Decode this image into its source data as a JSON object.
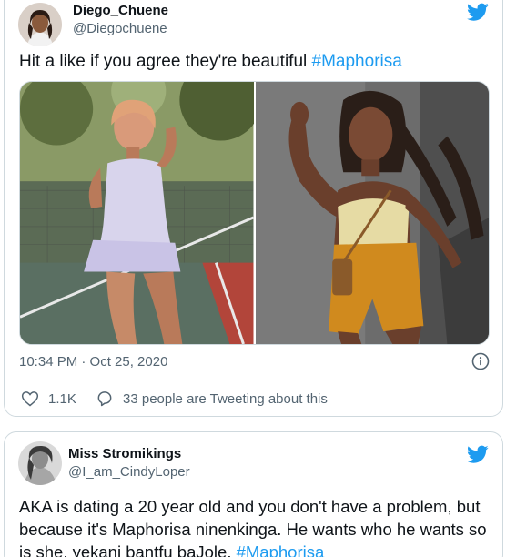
{
  "tweet1": {
    "display_name": "Diego_Chuene",
    "handle": "@Diegochuene",
    "text": "Hit a like if you agree they're beautiful ",
    "hashtag": "#Maphorisa",
    "timestamp": "10:34 PM · Oct 25, 2020",
    "like_count": "1.1K",
    "reply_text": "33 people are Tweeting about this",
    "icons": {
      "brand": "twitter-bird-icon",
      "info": "info-icon",
      "like": "heart-icon",
      "reply": "chat-bubble-icon"
    }
  },
  "tweet2": {
    "display_name": "Miss Stromikings",
    "handle": "@I_am_CindyLoper",
    "text": "AKA is dating a 20 year old and you don't have a problem, but because it's Maphorisa ninenkinga. He wants who he wants so is she, yekani bantfu baJole. ",
    "hashtag": "#Maphorisa"
  },
  "colors": {
    "accent": "#1d9bf0",
    "text": "#0f1419",
    "secondary": "#536471",
    "border": "#cfd9de"
  }
}
